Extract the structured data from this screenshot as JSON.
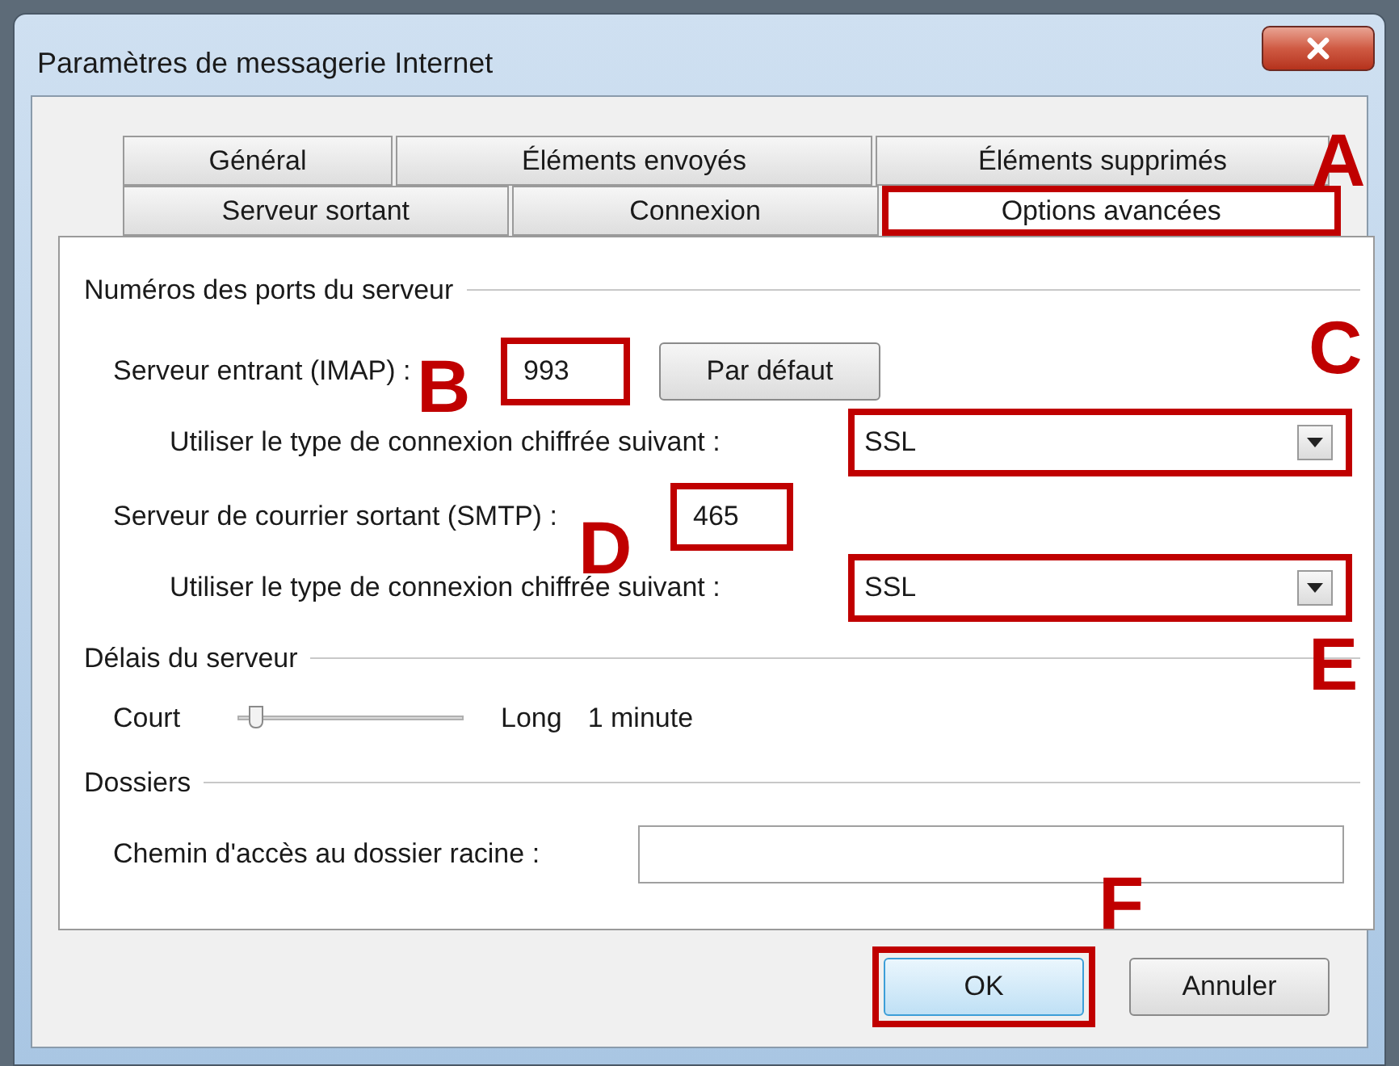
{
  "window": {
    "title": "Paramètres de messagerie Internet"
  },
  "tab_rows": [
    {
      "tabs": [
        {
          "label": "Général",
          "selected": false,
          "highlighted": false
        },
        {
          "label": "Éléments envoyés",
          "selected": false,
          "highlighted": false
        },
        {
          "label": "Éléments supprimés",
          "selected": false,
          "highlighted": false
        }
      ]
    },
    {
      "tabs": [
        {
          "label": "Serveur sortant",
          "selected": false,
          "highlighted": false
        },
        {
          "label": "Connexion",
          "selected": false,
          "highlighted": false
        },
        {
          "label": "Options avancées",
          "selected": true,
          "highlighted": true
        }
      ]
    }
  ],
  "ports": {
    "heading": "Numéros des ports du serveur",
    "incoming": {
      "label": "Serveur entrant (IMAP) :",
      "value": "993",
      "highlighted": true
    },
    "default_button": "Par défaut",
    "incoming_encryption": {
      "label": "Utiliser le type de connexion chiffrée suivant :",
      "value": "SSL",
      "highlighted": true
    },
    "outgoing": {
      "label": "Serveur de courrier sortant (SMTP) :",
      "value": "465",
      "highlighted": true
    },
    "outgoing_encryption": {
      "label": "Utiliser le type de connexion chiffrée suivant :",
      "value": "SSL",
      "highlighted": true
    }
  },
  "timeouts": {
    "heading": "Délais du serveur",
    "min_label": "Court",
    "max_label": "Long",
    "level": 0.08,
    "reading": "1 minute"
  },
  "folders": {
    "heading": "Dossiers",
    "root_path": {
      "label": "Chemin d'accès au dossier racine :"
    }
  },
  "buttons": [
    {
      "label": "OK",
      "highlighted": true
    },
    {
      "label": "Annuler",
      "highlighted": false
    }
  ],
  "annotations": [
    {
      "letter": "A"
    },
    {
      "letter": "B"
    },
    {
      "letter": "C"
    },
    {
      "letter": "D"
    },
    {
      "letter": "E"
    },
    {
      "letter": "F"
    }
  ]
}
